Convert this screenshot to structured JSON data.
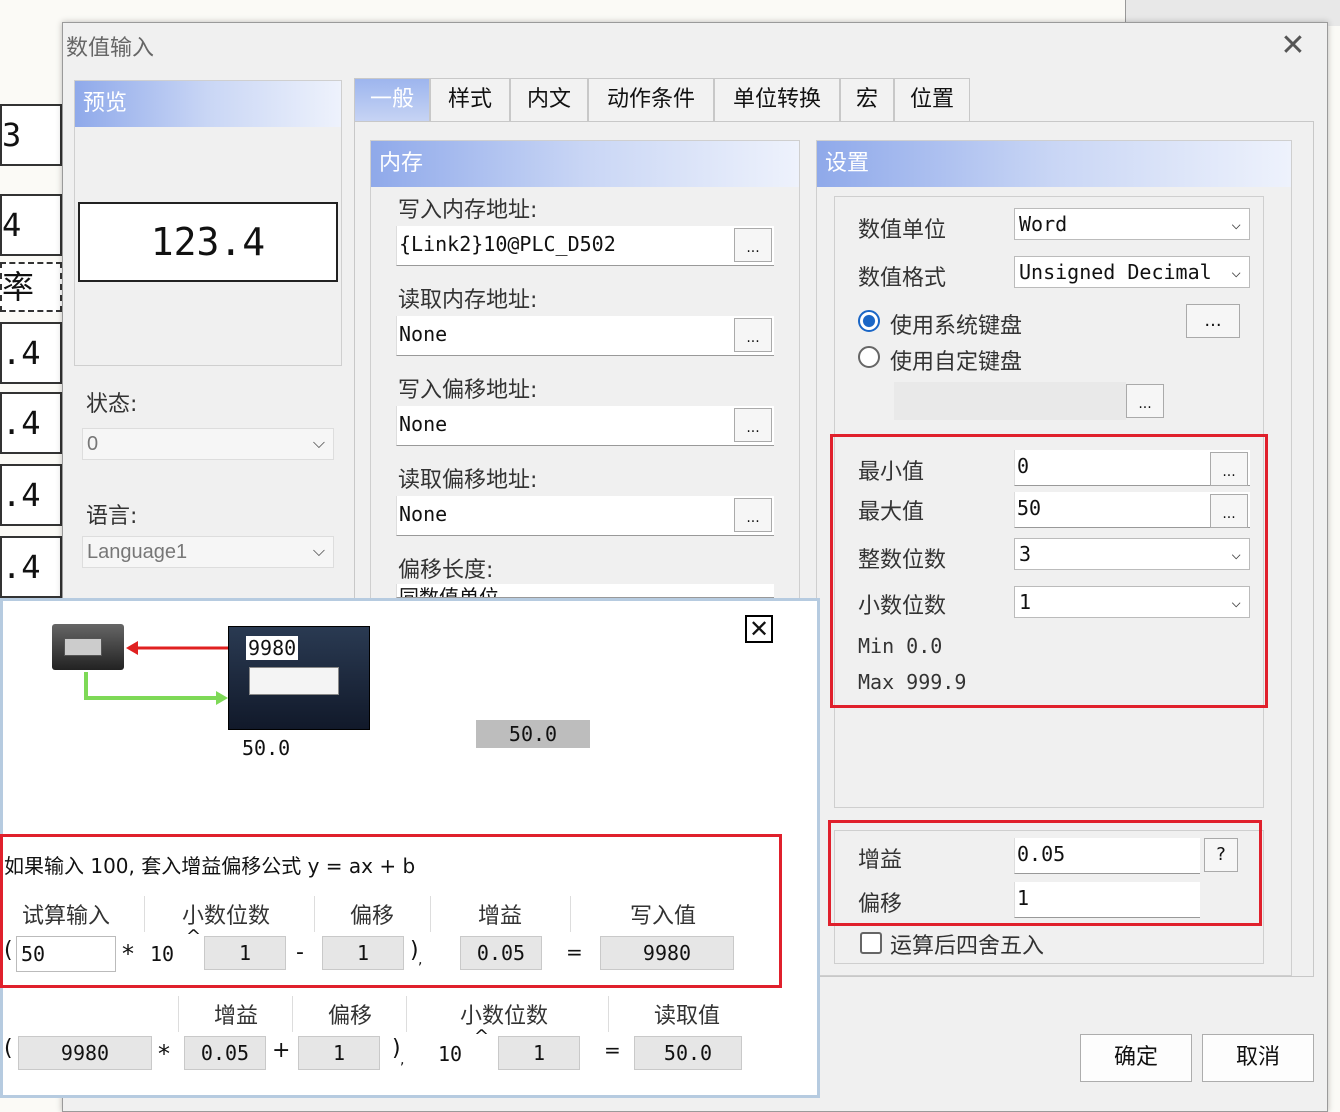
{
  "dialog": {
    "title": "数值输入",
    "tabs": [
      "一般",
      "样式",
      "内文",
      "动作条件",
      "单位转换",
      "宏",
      "位置"
    ],
    "ok_label": "确定",
    "cancel_label": "取消"
  },
  "background": {
    "cells": [
      "3",
      "4",
      "率",
      ".4",
      ".4",
      ".4",
      ".4"
    ]
  },
  "preview": {
    "header": "预览",
    "value": "123.4",
    "state_label": "状态:",
    "state_value": "0",
    "language_label": "语言:",
    "language_value": "Language1"
  },
  "memory": {
    "header": "内存",
    "write_label": "写入内存地址:",
    "write_value": "{Link2}10@PLC_D502",
    "read_label": "读取内存地址:",
    "read_value": "None",
    "write_offset_label": "写入偏移地址:",
    "write_offset_value": "None",
    "read_offset_label": "读取偏移地址:",
    "read_offset_value": "None",
    "offset_length_label": "偏移长度:",
    "offset_length_value": "同数值单位",
    "dots": "..."
  },
  "settings": {
    "header": "设置",
    "unit_label": "数值单位",
    "unit_value": "Word",
    "format_label": "数值格式",
    "format_value": "Unsigned Decimal",
    "system_keyboard": "使用系统键盘",
    "custom_keyboard": "使用自定键盘",
    "keyboard_dots": "...",
    "min_label": "最小值",
    "min_value": "0",
    "max_label": "最大值",
    "max_value": "50",
    "int_digits_label": "整数位数",
    "int_digits_value": "3",
    "dec_digits_label": "小数位数",
    "dec_digits_value": "1",
    "min_text": "Min 0.0",
    "max_text": "Max 999.9",
    "gain_label": "增益",
    "gain_value": "0.05",
    "help": "?",
    "offset_label": "偏移",
    "offset_value": "1",
    "round_label": "运算后四舍五入"
  },
  "overlay": {
    "close": "✕",
    "hmi_value": "9980",
    "hmi_caption": "50.0",
    "gray_display": "50.0",
    "formula_title": "如果输入 100, 套入增益偏移公式 y = ax + b",
    "row1_headers": [
      "试算输入",
      "小数位数",
      "偏移",
      "增益",
      "写入值"
    ],
    "row1": {
      "paren_open": "(",
      "input": "50",
      "times": "*",
      "ten": "10",
      "caret": "^",
      "decimals": "1",
      "minus": "-",
      "offset": "1",
      "paren_close": ")",
      "comma": ",",
      "gain": "0.05",
      "equals": "=",
      "result": "9980"
    },
    "row2_headers": [
      "增益",
      "偏移",
      "小数位数",
      "读取值"
    ],
    "row2": {
      "paren_open": "(",
      "input": "9980",
      "times": "*",
      "gain": "0.05",
      "plus": "+",
      "offset": "1",
      "paren_close": ")",
      "comma": ",",
      "ten": "10",
      "caret": "^",
      "decimals": "1",
      "equals": "=",
      "result": "50.0"
    }
  },
  "colors": {
    "highlight_red": "#e0202c",
    "header_blue": "#8fa9ea",
    "radio_blue": "#1a66c6"
  }
}
